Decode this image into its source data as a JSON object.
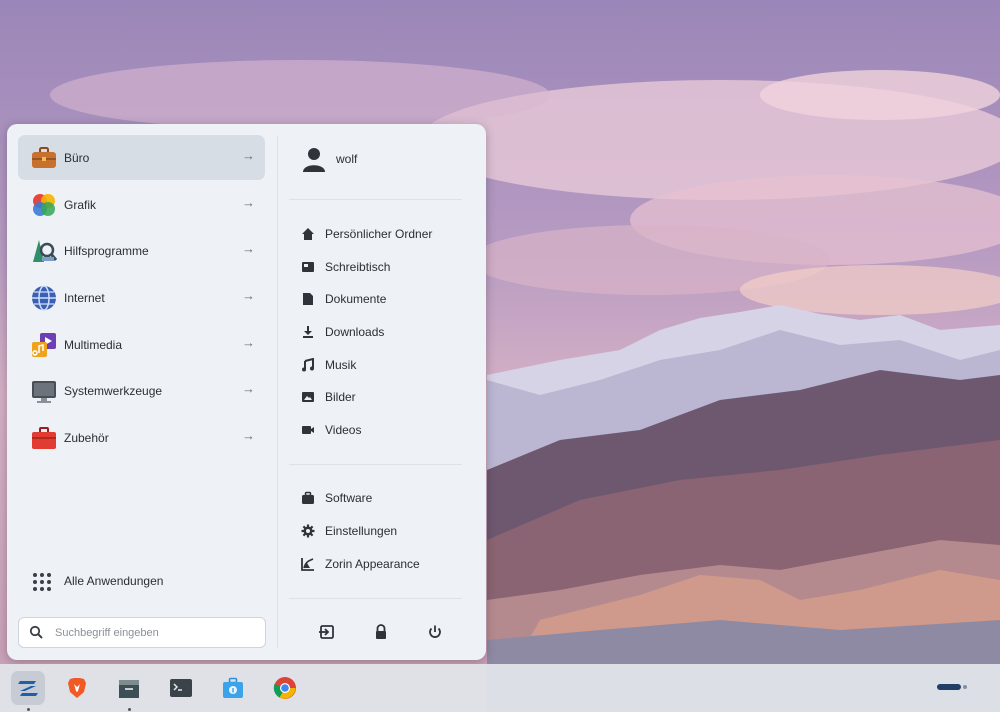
{
  "menu": {
    "categories": [
      {
        "label": "Büro",
        "icon": "briefcase-icon"
      },
      {
        "label": "Grafik",
        "icon": "graphics-palette-icon"
      },
      {
        "label": "Hilfsprogramme",
        "icon": "utilities-icon"
      },
      {
        "label": "Internet",
        "icon": "globe-icon"
      },
      {
        "label": "Multimedia",
        "icon": "multimedia-icon"
      },
      {
        "label": "Systemwerkzeuge",
        "icon": "monitor-icon"
      },
      {
        "label": "Zubehör",
        "icon": "toolbox-icon"
      }
    ],
    "arrow": "→",
    "all_apps_label": "Alle Anwendungen",
    "search_placeholder": "Suchbegriff eingeben",
    "user_name": "wolf",
    "places": [
      {
        "label": "Persönlicher Ordner",
        "icon": "home-icon"
      },
      {
        "label": "Schreibtisch",
        "icon": "desktop-icon"
      },
      {
        "label": "Dokumente",
        "icon": "document-icon"
      },
      {
        "label": "Downloads",
        "icon": "download-icon"
      },
      {
        "label": "Musik",
        "icon": "music-icon"
      },
      {
        "label": "Bilder",
        "icon": "image-icon"
      },
      {
        "label": "Videos",
        "icon": "video-icon"
      }
    ],
    "system": [
      {
        "label": "Software",
        "icon": "software-bag-icon"
      },
      {
        "label": "Einstellungen",
        "icon": "settings-gear-icon"
      },
      {
        "label": "Zorin Appearance",
        "icon": "appearance-icon"
      }
    ],
    "power_buttons": [
      "logout-icon",
      "lock-icon",
      "power-icon"
    ]
  },
  "taskbar": {
    "apps": [
      "zorin-menu-icon",
      "brave-browser-icon",
      "files-icon",
      "terminal-icon",
      "software-store-icon",
      "chrome-icon"
    ]
  },
  "colors": {
    "menu_bg": "#eef1f5",
    "active_bg": "#d7dde4",
    "taskbar_bg": "#e2e5eb"
  }
}
